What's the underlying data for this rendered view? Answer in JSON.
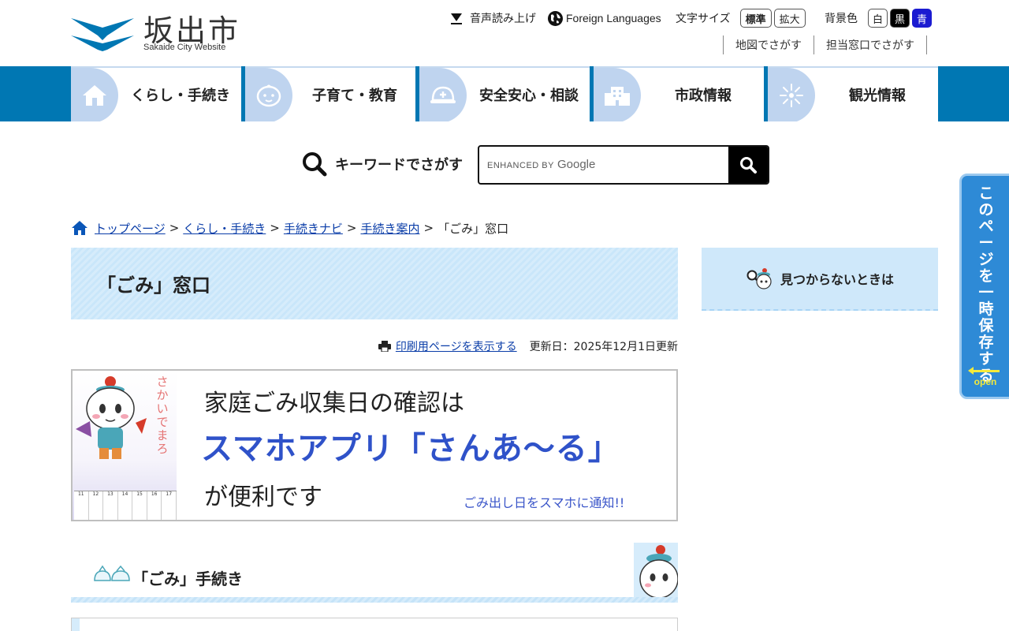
{
  "site": {
    "name": "坂出市",
    "subtitle": "Sakaide City Website"
  },
  "utility": {
    "voice_label": "音声読み上げ",
    "lang_label": "Foreign Languages",
    "font_size_label": "文字サイズ",
    "font_standard": "標準",
    "font_large": "拡大",
    "bg_label": "背景色",
    "bg_white": "白",
    "bg_black": "黒",
    "bg_blue": "青"
  },
  "sublinks": [
    "地図でさがす",
    "担当窓口でさがす"
  ],
  "nav": [
    {
      "label": "くらし・手続き",
      "icon": "house-icon"
    },
    {
      "label": "子育て・教育",
      "icon": "baby-icon"
    },
    {
      "label": "安全安心・相談",
      "icon": "helmet-icon"
    },
    {
      "label": "市政情報",
      "icon": "building-icon"
    },
    {
      "label": "観光情報",
      "icon": "firework-icon"
    }
  ],
  "search": {
    "label": "キーワードでさがす",
    "watermark_prefix": "ENHANCED BY",
    "watermark_brand": "Google"
  },
  "breadcrumb": {
    "links": [
      "トップページ",
      "くらし・手続き",
      "手続きナビ",
      "手続き案内"
    ],
    "current": "「ごみ」窓口",
    "separator": ">"
  },
  "page": {
    "title": "「ごみ」窓口",
    "print_link": "印刷用ページを表示する",
    "updated": "更新日：2025年12月1日更新"
  },
  "banner": {
    "line1": "家庭ごみ収集日の確認は",
    "line2": "スマホアプリ「さんあ～る」",
    "line3": "が便利です",
    "line4": "ごみ出し日をスマホに通知!!",
    "mascot_name": "さかいでまろ",
    "calendar_days": [
      "11",
      "12",
      "13",
      "14",
      "15",
      "16",
      "17"
    ]
  },
  "section": {
    "heading": "「ごみ」手続き"
  },
  "side": {
    "not_found": "見つからないときは"
  },
  "save_tab": {
    "text": "このページを一時保存する",
    "open": "open"
  },
  "colors": {
    "nav_band": "#0077b3",
    "nav_icon_bg": "#bfd4ef",
    "title_bg": "#d6ecfb",
    "link": "#0a3da8",
    "save_tab": "#2e8ad6",
    "banner_accent": "#2f52c9"
  }
}
